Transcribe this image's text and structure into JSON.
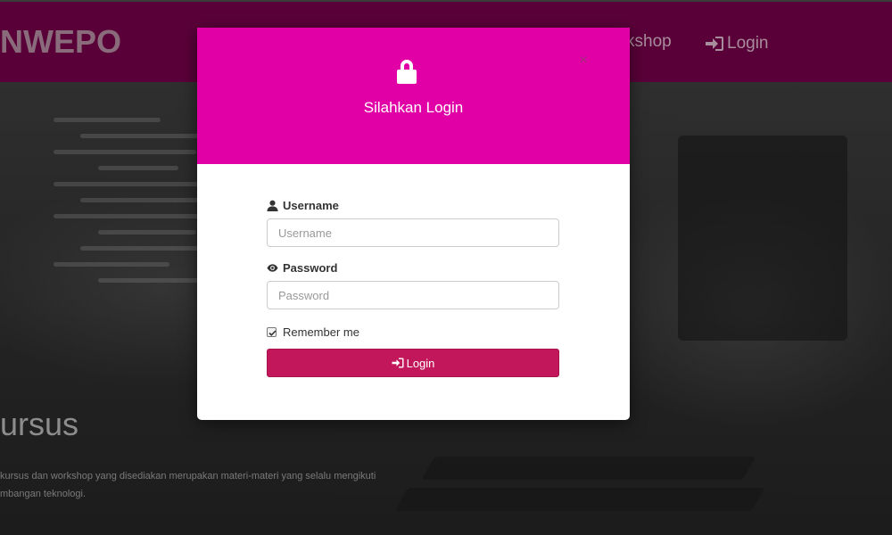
{
  "background": {
    "brand": "NWEPO",
    "nav": {
      "workshop_label": "kshop",
      "login_label": "Login"
    },
    "hero": {
      "title": "ursus",
      "description": "kursus dan workshop yang disediakan merupakan materi-materi yang selalu mengikuti mbangan teknologi."
    }
  },
  "modal": {
    "icon": "lock-icon",
    "title": "Silahkan Login",
    "close_label": "×",
    "username": {
      "label": "Username",
      "icon": "user-icon",
      "value": "",
      "placeholder": "Username"
    },
    "password": {
      "label": "Password",
      "icon": "eye-icon",
      "value": "",
      "placeholder": "Password"
    },
    "remember": {
      "label": "Remember me",
      "checked": true
    },
    "submit": {
      "label": "Login",
      "icon": "sign-in-icon"
    }
  },
  "colors": {
    "navbar": "#5a0039",
    "modal_header": "#e000a5",
    "login_button": "#c2185b"
  }
}
